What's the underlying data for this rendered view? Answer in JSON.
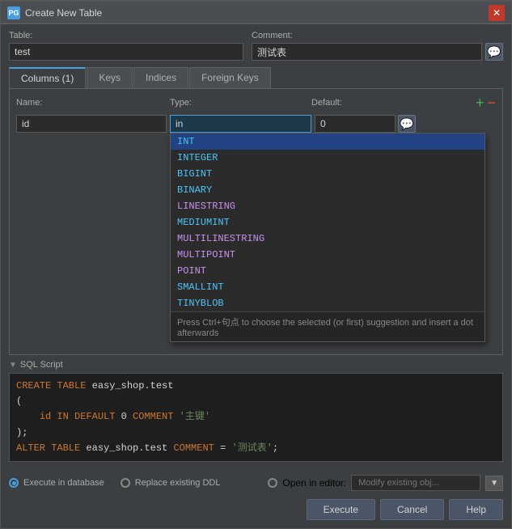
{
  "titlebar": {
    "icon": "PG",
    "title": "Create New Table",
    "close_label": "✕"
  },
  "table_field": {
    "label": "Table:",
    "value": "test"
  },
  "comment_field": {
    "label": "Comment:",
    "value": "测试表",
    "icon": "💬"
  },
  "tabs": [
    {
      "label": "Columns (1)",
      "active": true
    },
    {
      "label": "Keys",
      "active": false
    },
    {
      "label": "Indices",
      "active": false
    },
    {
      "label": "Foreign Keys",
      "active": false
    }
  ],
  "columns_header": {
    "name_label": "Name:",
    "type_label": "Type:",
    "default_label": "Default:",
    "add_icon": "+",
    "remove_icon": "−"
  },
  "column_row": {
    "name": "id",
    "type": "in",
    "default_value": "0"
  },
  "dropdown": {
    "items": [
      {
        "label": "INT",
        "color": "cyan"
      },
      {
        "label": "INTEGER",
        "color": "cyan"
      },
      {
        "label": "BIGINT",
        "color": "cyan"
      },
      {
        "label": "BINARY",
        "color": "cyan"
      },
      {
        "label": "LINESTRING",
        "color": "purple"
      },
      {
        "label": "MEDIUMINT",
        "color": "cyan"
      },
      {
        "label": "MULTILINESTRING",
        "color": "purple"
      },
      {
        "label": "MULTIPOINT",
        "color": "purple"
      },
      {
        "label": "POINT",
        "color": "purple"
      },
      {
        "label": "SMALLINT",
        "color": "cyan"
      },
      {
        "label": "TINYBLOB",
        "color": "cyan"
      }
    ],
    "hint": "Press Ctrl+句点 to choose the selected (or first) suggestion and insert a dot afterwards"
  },
  "sql_section": {
    "toggle_label": "▼",
    "section_label": "SQL Script",
    "line1_kw": "CREATE TABLE",
    "line1_name": " easy_shop.test",
    "line2": "(",
    "line3_indent": "    ",
    "line3_col": "id",
    "line3_kw1": " IN",
    "line3_kw2": " DEFAULT",
    "line3_num": " 0",
    "line3_kw3": " COMMENT",
    "line3_str": " '主键'",
    "line4": ");",
    "line5_kw": "ALTER TABLE",
    "line5_name": " easy_shop.test",
    "line5_kw2": " COMMENT",
    "line5_eq": " =",
    "line5_str": " '测试表'",
    "line5_end": ";"
  },
  "footer": {
    "radio1_label": "Execute in database",
    "radio2_label": "Replace existing DDL",
    "radio3_label": "Open in editor:",
    "open_editor_placeholder": "Modify existing obj...",
    "execute_label": "Execute",
    "cancel_label": "Cancel",
    "help_label": "Help"
  }
}
